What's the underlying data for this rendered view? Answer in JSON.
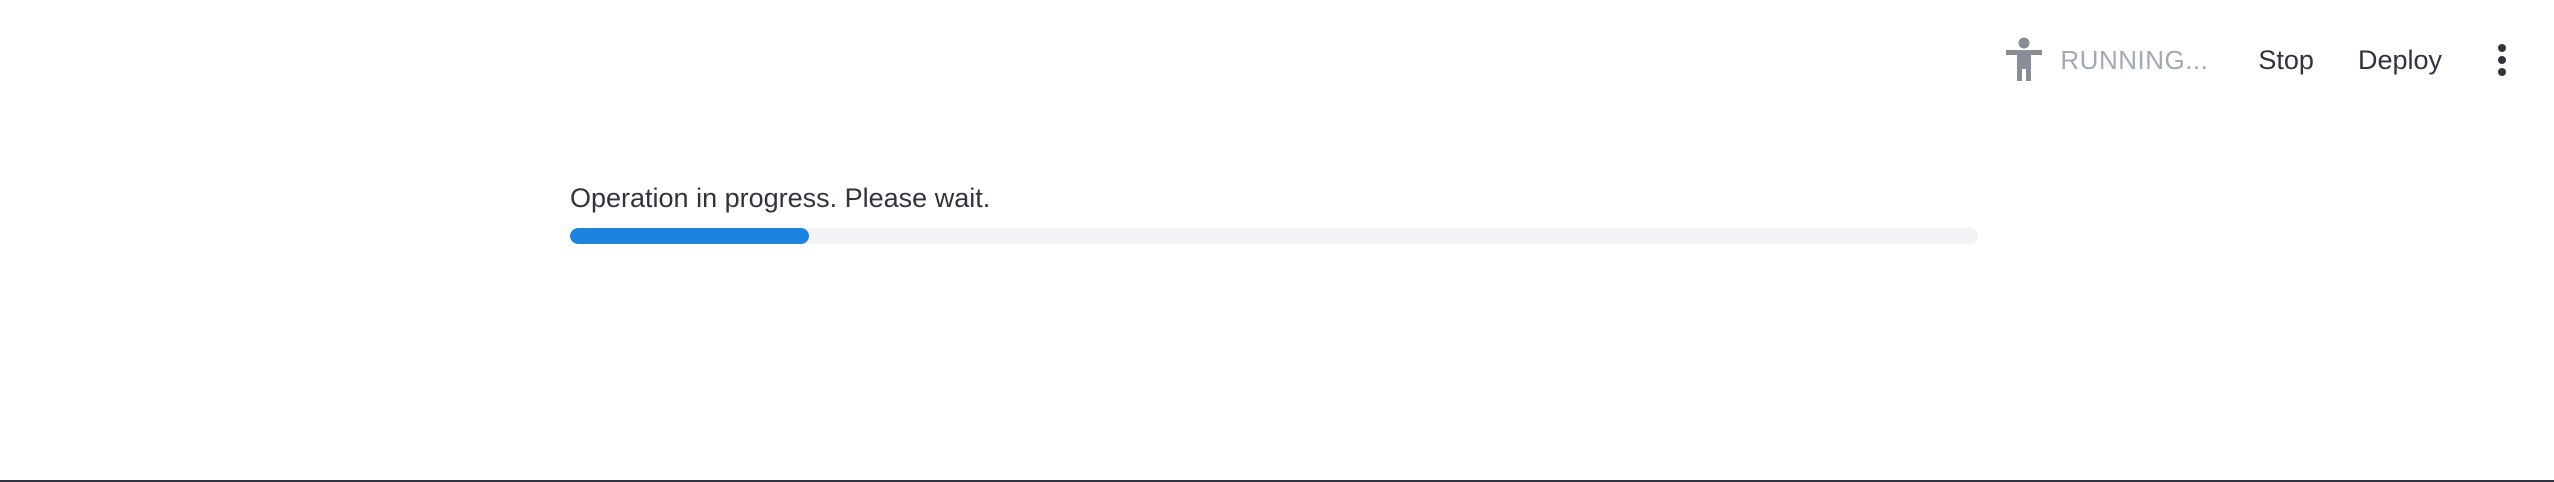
{
  "header": {
    "status_icon": "person-running-icon",
    "status_text": "RUNNING...",
    "stop_label": "Stop",
    "deploy_label": "Deploy",
    "menu_icon": "vertical-ellipsis-icon"
  },
  "main": {
    "progress_text": "Operation in progress. Please wait.",
    "progress_fraction": 0.17
  },
  "colors": {
    "accent": "#1c83e1",
    "track": "#f0f2f6",
    "status_text": "#a3a8b8",
    "text": "#31333f"
  }
}
